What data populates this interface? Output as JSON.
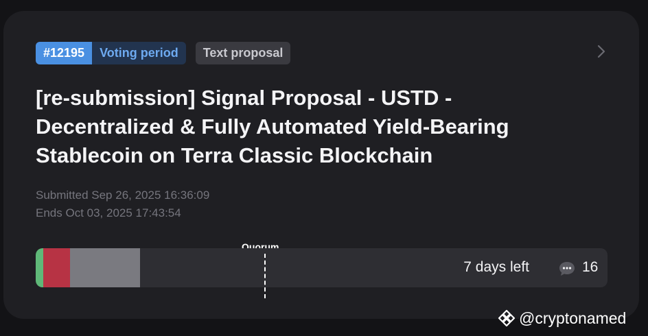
{
  "proposal": {
    "id": "#12195",
    "status": "Voting period",
    "type": "Text proposal",
    "title": "[re-submission] Signal Proposal - USTD - Decentralized & Fully Automated Yield-Bearing Stablecoin on Terra Classic Blockchain",
    "submitted": "Submitted Sep 26, 2025 16:36:09",
    "ends": "Ends Oct 03, 2025 17:43:54"
  },
  "vote_bar": {
    "quorum_label": "Quorum",
    "quorum_fraction": 0.4,
    "segments": [
      {
        "name": "yes",
        "color": "#5fb878",
        "fraction": 0.013
      },
      {
        "name": "no",
        "color": "#b73344",
        "fraction": 0.047
      },
      {
        "name": "abstain",
        "color": "#7a7a80",
        "fraction": 0.122
      }
    ],
    "days_left": "7 days left",
    "comments_count": "16"
  },
  "icons": {
    "chevron": "chevron-right-icon",
    "comments": "speech-bubble-icon",
    "watermark_logo": "binance-logo-icon"
  },
  "watermark": {
    "handle": "@cryptonamed"
  }
}
